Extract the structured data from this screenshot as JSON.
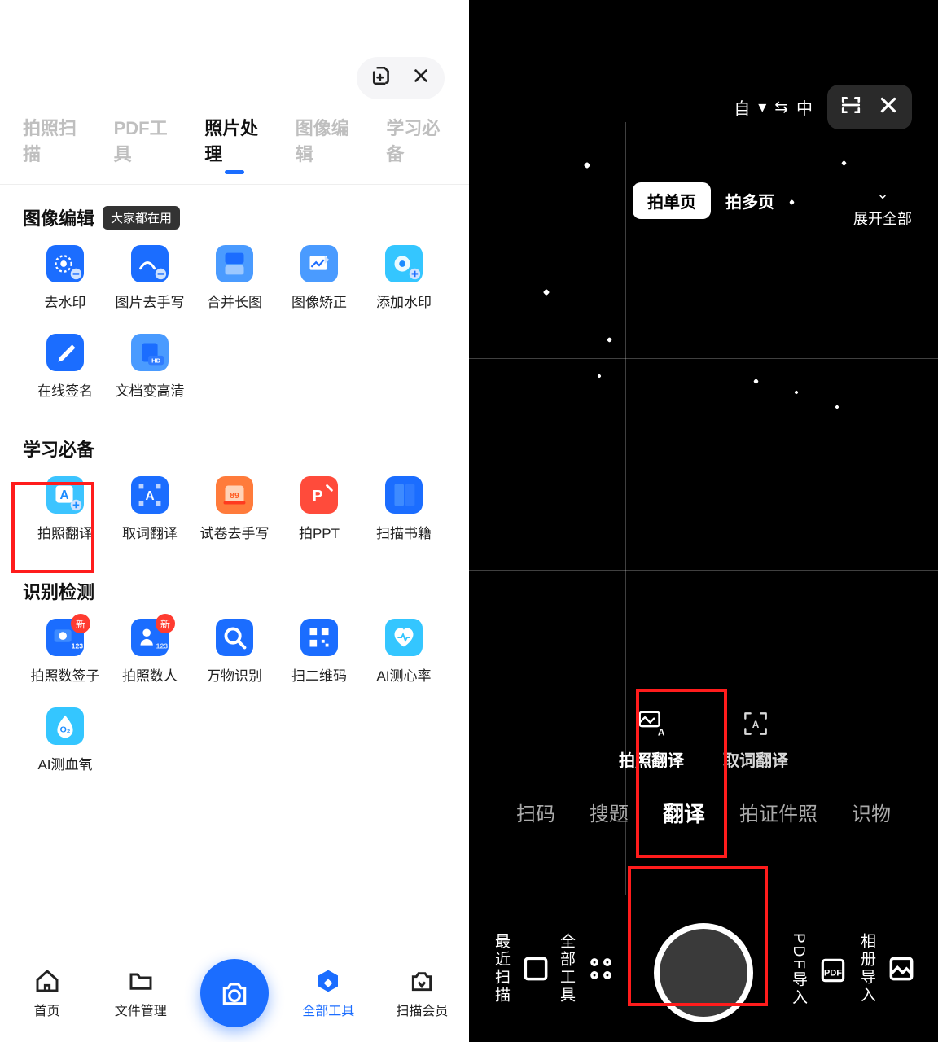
{
  "left": {
    "top_actions": {
      "add_icon": "add-icon",
      "close_icon": "close-icon"
    },
    "tabs": [
      {
        "label": "拍照扫描",
        "active": false
      },
      {
        "label": "PDF工具",
        "active": false
      },
      {
        "label": "照片处理",
        "active": true
      },
      {
        "label": "图像编辑",
        "active": false
      },
      {
        "label": "学习必备",
        "active": false
      }
    ],
    "sections": [
      {
        "title": "图像编辑",
        "badge": "大家都在用",
        "items": [
          {
            "label": "去水印",
            "icon": "circle-erase"
          },
          {
            "label": "图片去手写",
            "icon": "handwrite"
          },
          {
            "label": "合并长图",
            "icon": "merge"
          },
          {
            "label": "图像矫正",
            "icon": "photo-fix"
          },
          {
            "label": "添加水印",
            "icon": "watermark-add"
          },
          {
            "label": "在线签名",
            "icon": "signature"
          },
          {
            "label": "文档变高清",
            "icon": "hd-doc"
          }
        ]
      },
      {
        "title": "学习必备",
        "items": [
          {
            "label": "拍照翻译",
            "icon": "photo-trans",
            "highlight": true
          },
          {
            "label": "取词翻译",
            "icon": "word-trans"
          },
          {
            "label": "试卷去手写",
            "icon": "exam-erase"
          },
          {
            "label": "拍PPT",
            "icon": "ppt"
          },
          {
            "label": "扫描书籍",
            "icon": "scan-book"
          }
        ]
      },
      {
        "title": "识别检测",
        "items": [
          {
            "label": "拍照数签子",
            "icon": "count-sticks",
            "new": true
          },
          {
            "label": "拍照数人",
            "icon": "count-people",
            "new": true
          },
          {
            "label": "万物识别",
            "icon": "thing-search"
          },
          {
            "label": "扫二维码",
            "icon": "qr"
          },
          {
            "label": "AI测心率",
            "icon": "heart"
          },
          {
            "label": "AI测血氧",
            "icon": "oxygen"
          }
        ]
      }
    ],
    "bottom_nav": [
      {
        "label": "首页",
        "icon": "home"
      },
      {
        "label": "文件管理",
        "icon": "folder"
      },
      {
        "label": "",
        "icon": "camera-fab"
      },
      {
        "label": "全部工具",
        "icon": "hex",
        "highlight": true
      },
      {
        "label": "扫描会员",
        "icon": "camera-vip"
      }
    ],
    "new_badge_text": "新"
  },
  "right": {
    "lang": {
      "from": "自",
      "arrow": "⇆",
      "to": "中"
    },
    "top_icons": [
      "viewfinder-icon",
      "close-icon"
    ],
    "mode_pills": {
      "single": "拍单页",
      "multi": "拍多页"
    },
    "expand_label": "展开全部",
    "sub_modes": [
      {
        "label": "拍照翻译",
        "highlight": true
      },
      {
        "label": "取词翻译"
      }
    ],
    "categories": [
      {
        "label": "扫码"
      },
      {
        "label": "搜题"
      },
      {
        "label": "翻译",
        "active": true
      },
      {
        "label": "拍证件照"
      },
      {
        "label": "识物"
      }
    ],
    "side_tools": {
      "left1": "最近扫描",
      "left2": "全部工具",
      "right1": "PDF导入",
      "right2": "相册导入"
    }
  }
}
